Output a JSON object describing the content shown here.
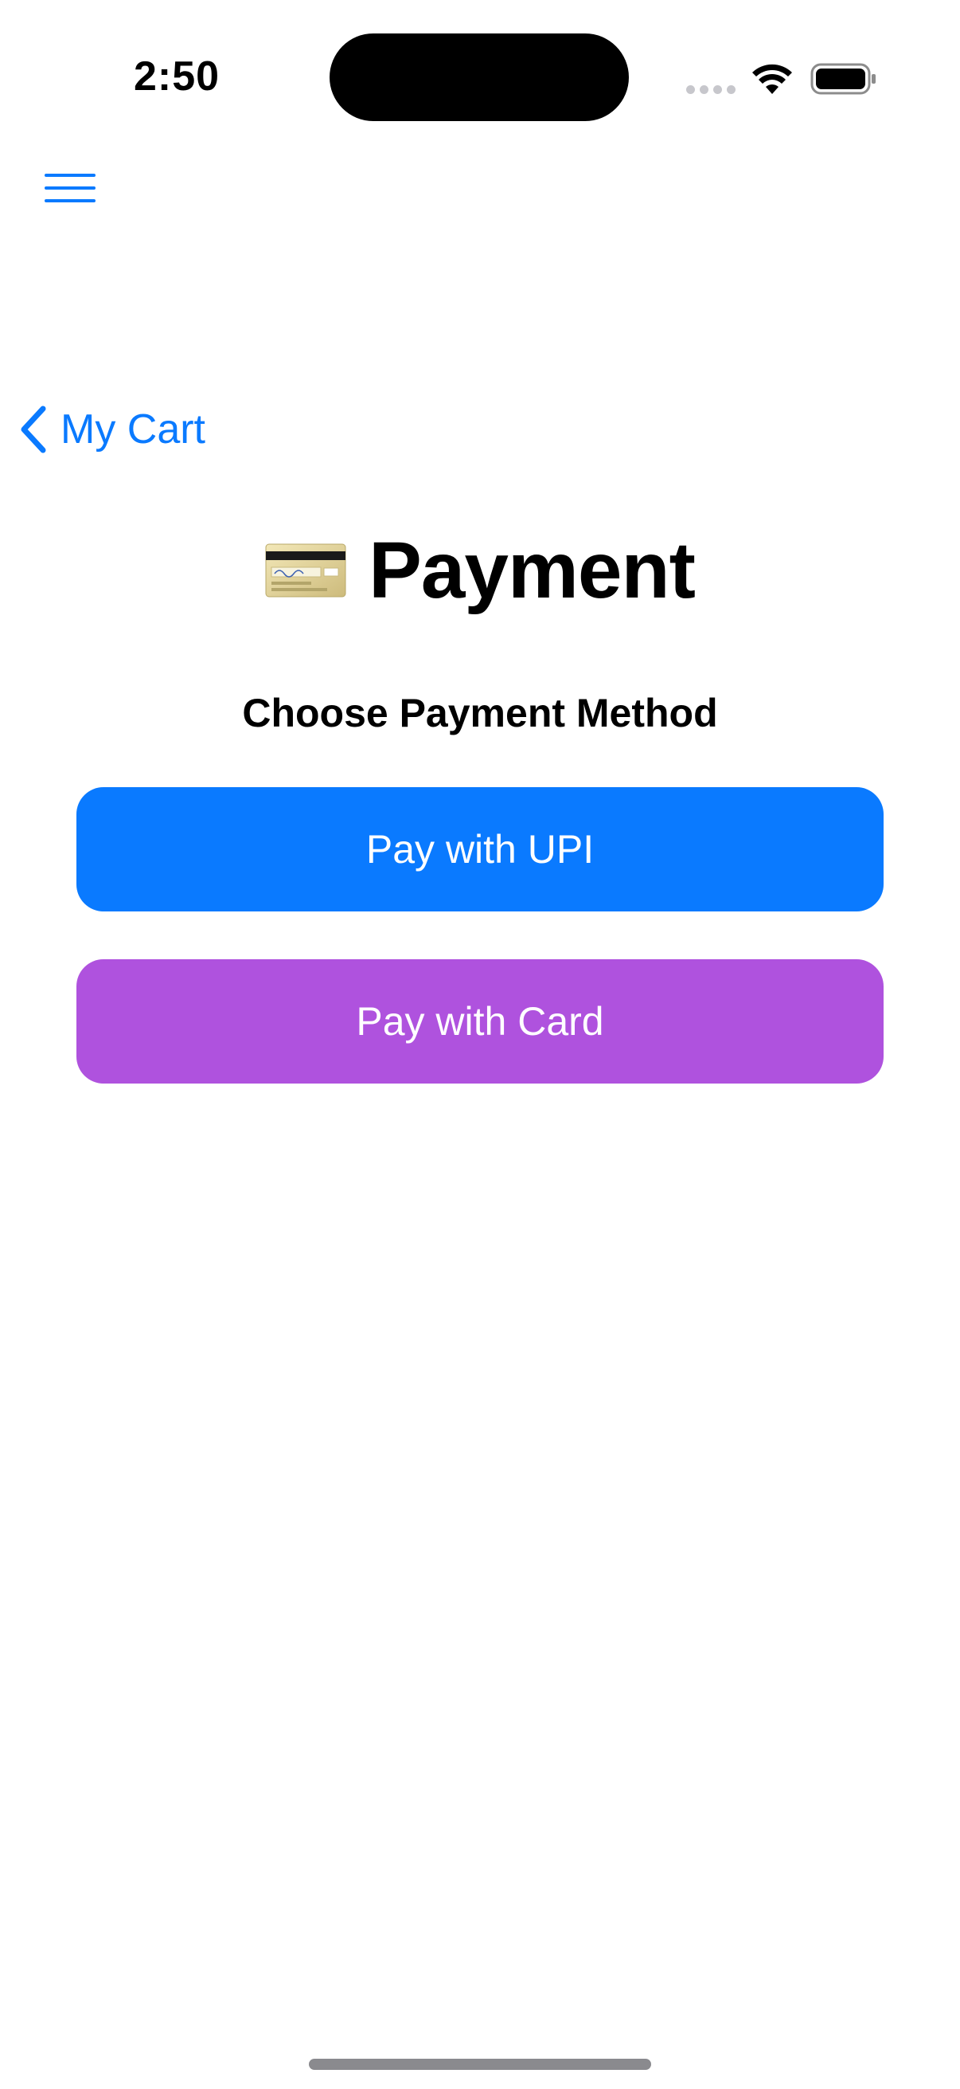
{
  "status_bar": {
    "time": "2:50"
  },
  "nav": {
    "menu_icon": "hamburger-menu-icon",
    "back_icon": "chevron-left-icon",
    "back_label": "My Cart"
  },
  "page": {
    "title_icon": "credit-card-emoji",
    "title": "Payment",
    "subtitle": "Choose Payment Method"
  },
  "buttons": {
    "upi_label": "Pay with UPI",
    "card_label": "Pay with Card"
  },
  "colors": {
    "accent": "#0a7aff",
    "upi_button": "#0a7aff",
    "card_button": "#af52de"
  }
}
